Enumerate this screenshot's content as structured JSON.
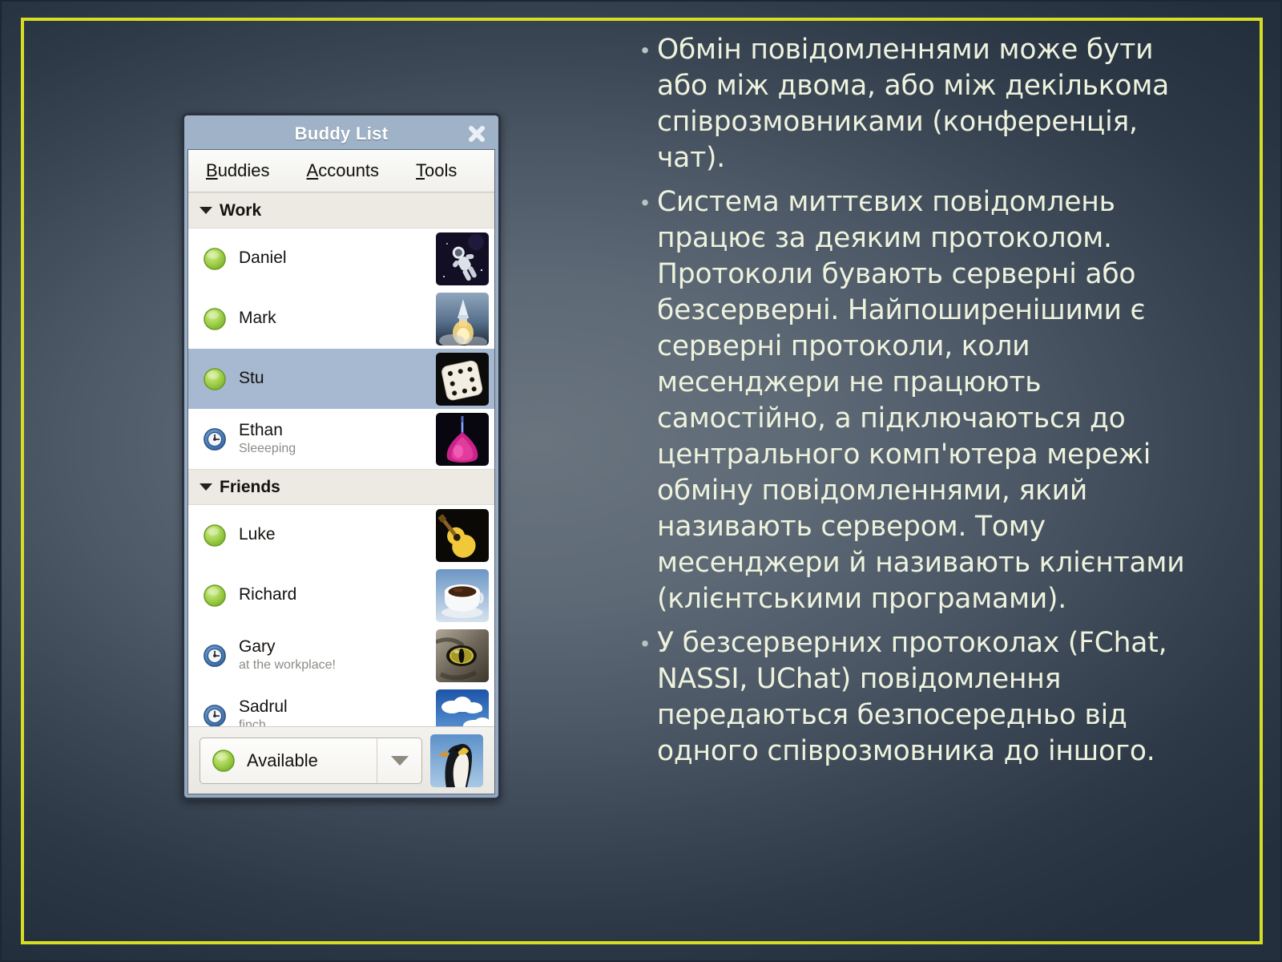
{
  "slide": {
    "background_dark": "#232f3d",
    "background_light": "#69747f",
    "accent_border_color": "#d6dd22"
  },
  "window": {
    "title": "Buddy List",
    "close_icon": "close-icon",
    "menu": [
      {
        "label": "Buddies",
        "mnemonic": "B",
        "rest": "uddies"
      },
      {
        "label": "Accounts",
        "mnemonic": "A",
        "rest": "ccounts"
      },
      {
        "label": "Tools",
        "mnemonic": "T",
        "rest": "ools"
      }
    ],
    "groups": [
      {
        "name": "Work",
        "expanded": true,
        "buddies": [
          {
            "name": "Daniel",
            "status_message": "",
            "presence": "available",
            "selected": false,
            "avatar": "astronaut"
          },
          {
            "name": "Mark",
            "status_message": "",
            "presence": "available",
            "selected": false,
            "avatar": "shuttle-launch"
          },
          {
            "name": "Stu",
            "status_message": "",
            "presence": "available",
            "selected": true,
            "avatar": "dice"
          },
          {
            "name": "Ethan",
            "status_message": "Sleeeping",
            "presence": "away",
            "selected": false,
            "avatar": "lava-lamp"
          }
        ]
      },
      {
        "name": "Friends",
        "expanded": true,
        "buddies": [
          {
            "name": "Luke",
            "status_message": "",
            "presence": "available",
            "selected": false,
            "avatar": "guitar"
          },
          {
            "name": "Richard",
            "status_message": "",
            "presence": "available",
            "selected": false,
            "avatar": "coffee-cup"
          },
          {
            "name": "Gary",
            "status_message": "at the workplace!",
            "presence": "away",
            "selected": false,
            "avatar": "cat-eye"
          },
          {
            "name": "Sadrul",
            "status_message": "finch",
            "presence": "away",
            "selected": false,
            "avatar": "clouds-sky"
          }
        ]
      }
    ],
    "status_selector": {
      "value": "Available",
      "presence": "available",
      "dropdown_icon": "chevron-down-icon",
      "account_avatar": "penguin"
    },
    "colors": {
      "titlebar_top": "#9fb2c8",
      "titlebar_bottom": "#93a7bf",
      "selected_row": "#a6b9d1",
      "group_header": "#eceae3",
      "available_dot": "#8cc63f",
      "away_dot": "#3f6fa8"
    }
  },
  "text_pane": {
    "bullet_char": "•",
    "bullets": [
      "Обмін повідомленнями може бути або між двома, або між декількома співрозмовниками (конференція, чат).",
      "Система миттєвих повідомлень працює за деяким протоколом. Протоколи бувають серверні або безсерверні. Найпоширенішими є серверні протоколи, коли месенджери не працюють самостійно, а підключаються до центрального комп'ютера мережі обміну повідомленнями, який називають сервером. Тому месенджери й називають клієнтами (клієнтськими програмами).",
      "У безсерверних протоколах (FChat, NASSI, UChat) повідомлення передаються безпосередньо від одного співрозмовника до іншого."
    ]
  }
}
